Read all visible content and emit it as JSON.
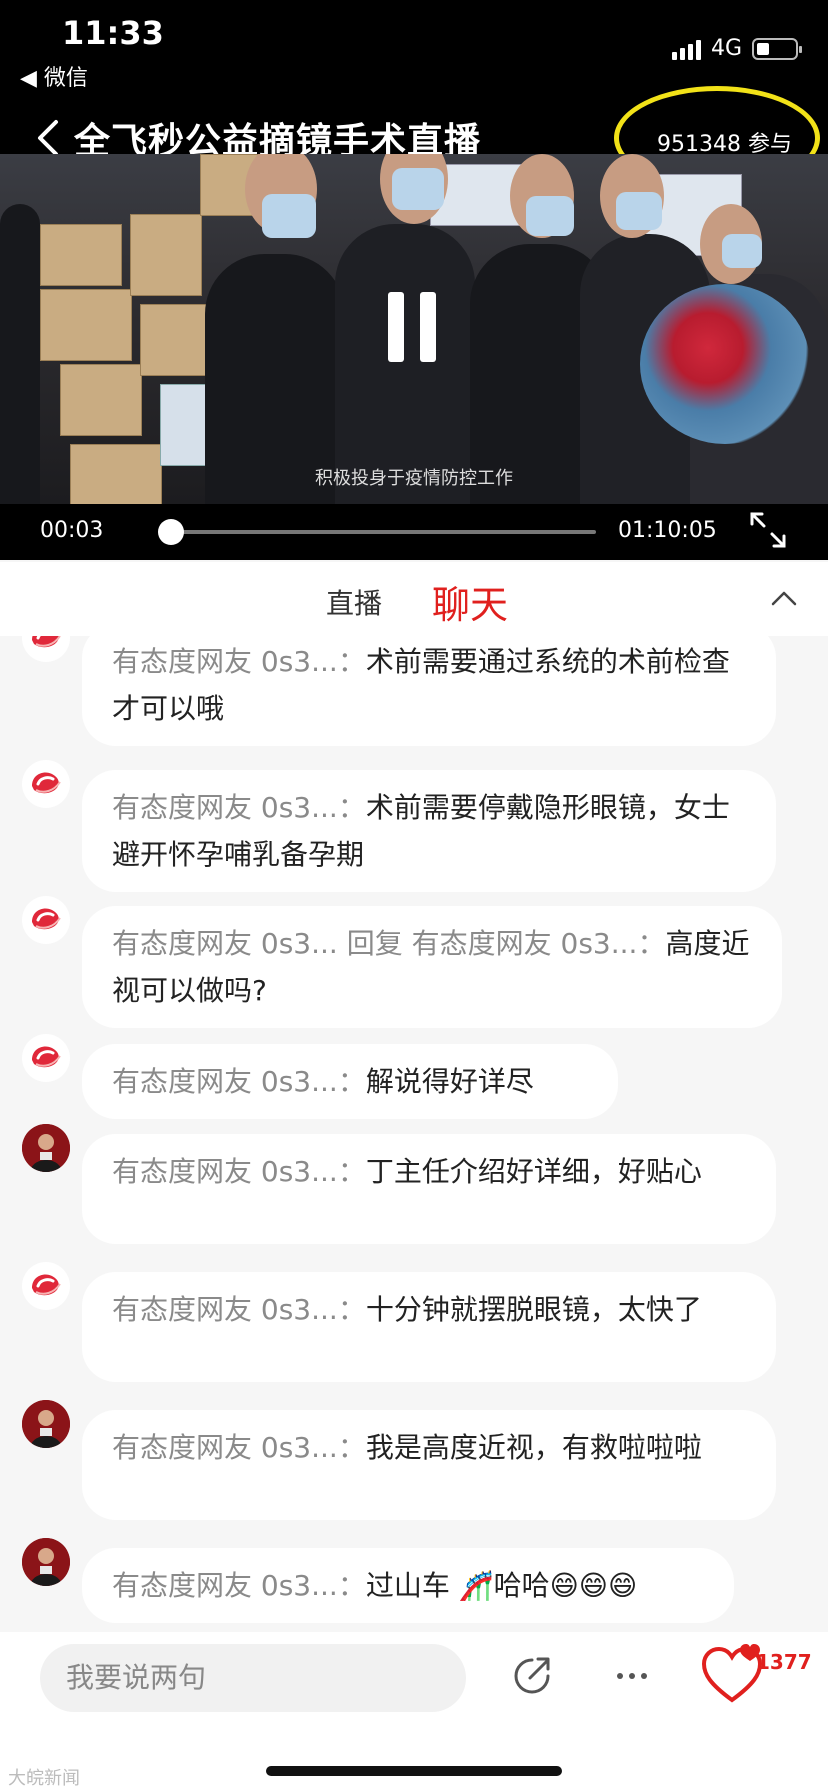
{
  "status_bar": {
    "time": "11:33",
    "back_app": "◀ 微信",
    "network": "4G"
  },
  "nav": {
    "title": "全飞秒公益摘镜手术直播",
    "participants": "951348 参与"
  },
  "video": {
    "subtitle": "积极投身于疫情防控工作",
    "current_time": "00:03",
    "total_time": "01:10:05",
    "progress_fraction": 0.0007
  },
  "tabs": {
    "live": "直播",
    "chat": "聊天"
  },
  "chat": {
    "messages": [
      {
        "user": "有态度网友 0s3...：",
        "text": "术前需要通过系统的术前检查才可以哦",
        "avatar": "logo"
      },
      {
        "user": "有态度网友 0s3...：",
        "text": "术前需要停戴隐形眼镜，女士避开怀孕哺乳备孕期",
        "avatar": "logo"
      },
      {
        "user": "有态度网友 0s3... 回复 有态度网友 0s3...：",
        "text": "高度近视可以做吗?",
        "avatar": "logo"
      },
      {
        "user": "有态度网友 0s3...：",
        "text": "解说得好详尽",
        "avatar": "logo"
      },
      {
        "user": "有态度网友 0s3...：",
        "text": "丁主任介绍好详细，好贴心",
        "avatar": "photo"
      },
      {
        "user": "有态度网友 0s3...：",
        "text": "十分钟就摆脱眼镜，太快了",
        "avatar": "logo"
      },
      {
        "user": "有态度网友 0s3...：",
        "text": "我是高度近视，有救啦啦啦",
        "avatar": "photo"
      },
      {
        "user": "有态度网友 0s3...：",
        "text": "过山车 🎢哈哈😄😄😄",
        "avatar": "photo"
      }
    ]
  },
  "bottom": {
    "input_placeholder": "我要说两句",
    "like_count": "1377",
    "watermark": "大皖新闻"
  },
  "colors": {
    "accent_red": "#e0201e",
    "highlight_yellow": "#f2e218"
  }
}
